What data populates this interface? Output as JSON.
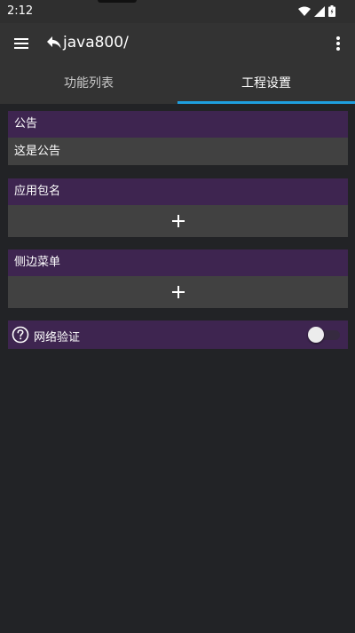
{
  "status_bar": {
    "time": "2:12",
    "icons": [
      "wifi-icon",
      "signal-icon",
      "battery-icon"
    ]
  },
  "app_bar": {
    "title": "java800/",
    "icons": [
      "menu-icon",
      "back-icon",
      "overflow-menu-icon"
    ]
  },
  "tabs": [
    {
      "label": "功能列表",
      "selected": false
    },
    {
      "label": "工程设置",
      "selected": true
    }
  ],
  "notice": {
    "header": "公告",
    "value": "这是公告"
  },
  "package_name": {
    "header": "应用包名",
    "add_icon": "plus-icon"
  },
  "side_menu": {
    "header": "侧边菜单",
    "add_icon": "plus-icon"
  },
  "network_verify": {
    "label": "网络验证",
    "help_icon": "help-circle-icon",
    "enabled": false
  },
  "colors": {
    "background": "#222326",
    "app_bar": "#333333",
    "card_header": "#3e2550",
    "card_body": "#414141",
    "tab_indicator": "#1e9fe0"
  }
}
